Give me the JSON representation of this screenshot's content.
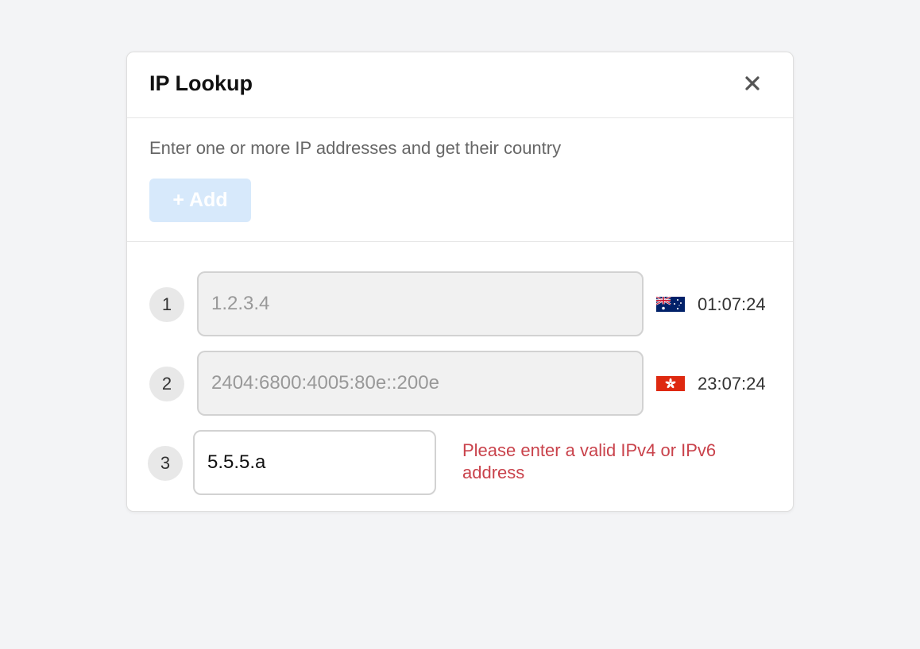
{
  "dialog": {
    "title": "IP Lookup",
    "close_label": "×",
    "description": "Enter one or more IP addresses and get their country",
    "add_label": "+ Add"
  },
  "rows": [
    {
      "index": "1",
      "value": "1.2.3.4",
      "flag_icon": "australia-flag-icon",
      "time": "01:07:24"
    },
    {
      "index": "2",
      "value": "2404:6800:4005:80e::200e",
      "flag_icon": "hong-kong-flag-icon",
      "time": "23:07:24"
    },
    {
      "index": "3",
      "value": "5.5.5.a",
      "error": "Please enter a valid IPv4 or IPv6 address"
    }
  ],
  "colors": {
    "background": "#f3f4f6",
    "add_button_disabled": "#d7e9fb",
    "error": "#c9424b"
  }
}
